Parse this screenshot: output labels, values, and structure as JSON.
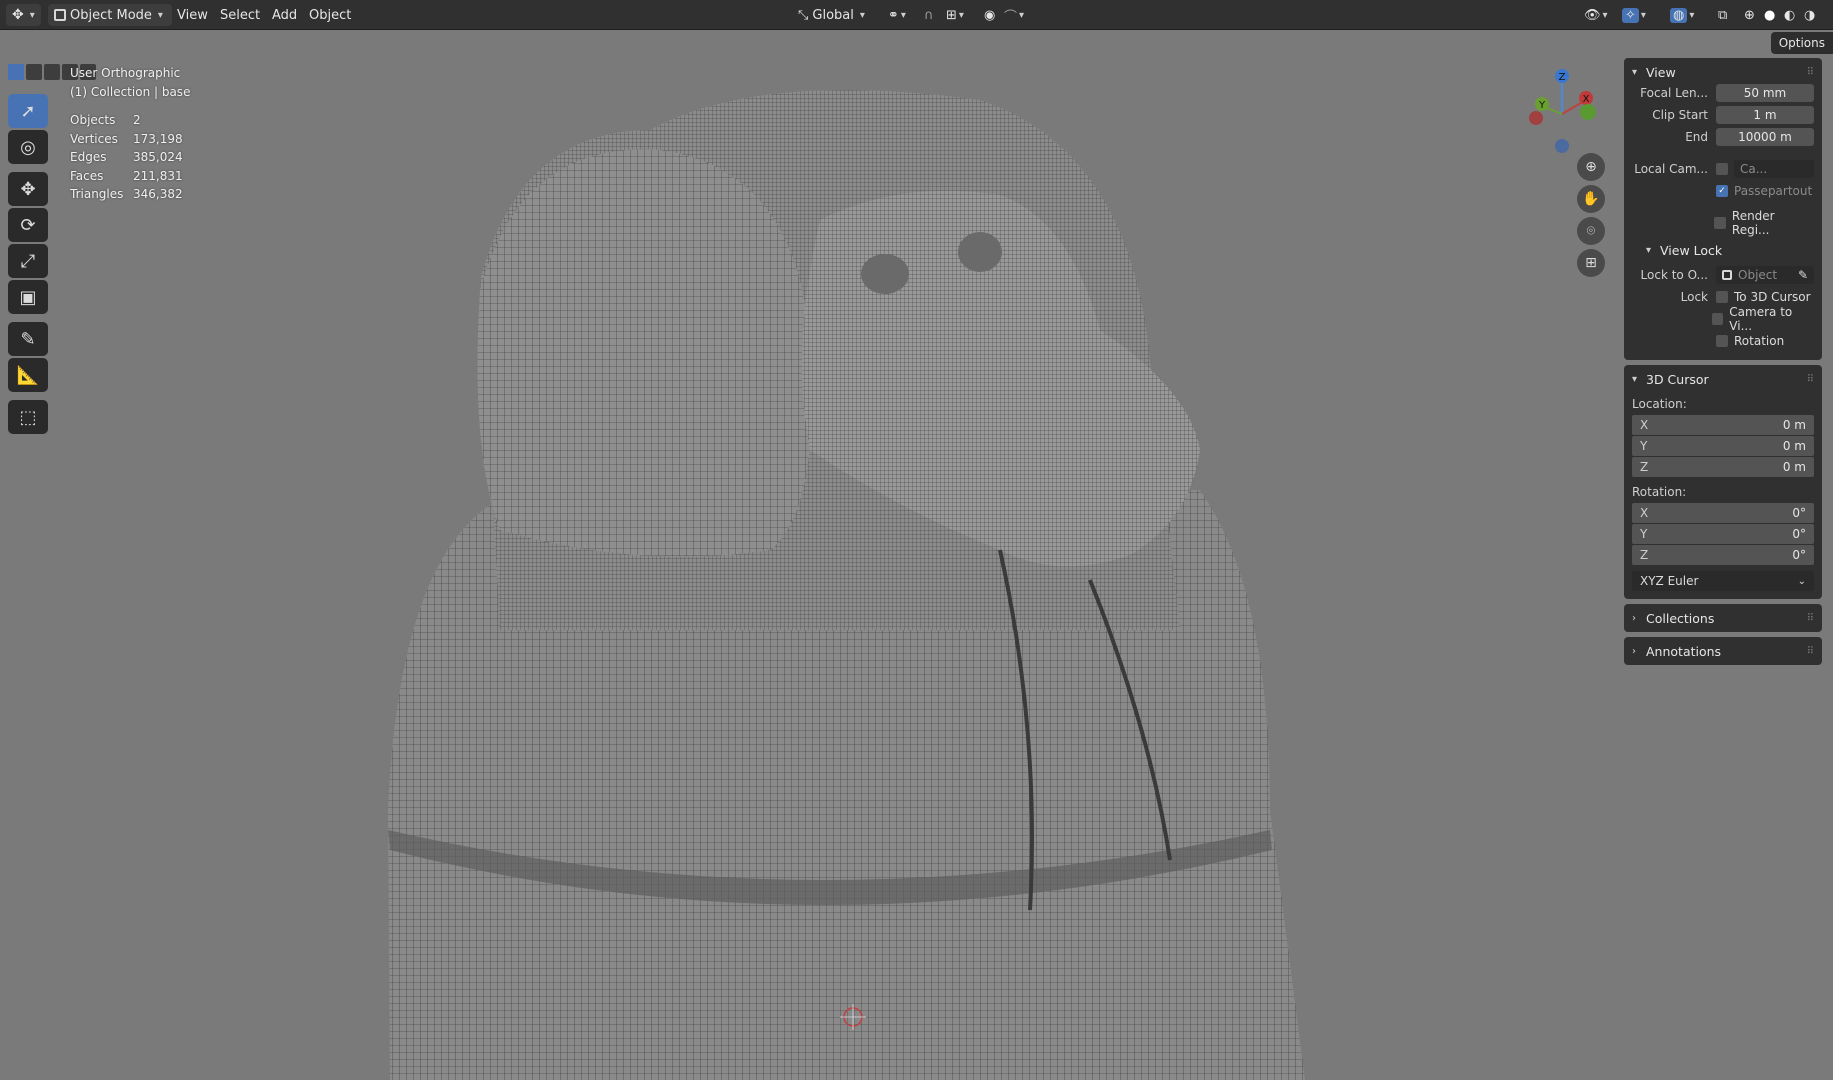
{
  "topbar": {
    "mode": "Object Mode",
    "menus": [
      "View",
      "Select",
      "Add",
      "Object"
    ],
    "orientation": "Global"
  },
  "viewport": {
    "view_name": "User Orthographic",
    "collection": "(1) Collection | base",
    "stats": [
      {
        "label": "Objects",
        "value": "2"
      },
      {
        "label": "Vertices",
        "value": "173,198"
      },
      {
        "label": "Edges",
        "value": "385,024"
      },
      {
        "label": "Faces",
        "value": "211,831"
      },
      {
        "label": "Triangles",
        "value": "346,382"
      }
    ],
    "gizmo": {
      "z": "Z",
      "y": "Y",
      "x": "X"
    },
    "options_label": "Options"
  },
  "npanel": {
    "view": {
      "title": "View",
      "focal_label": "Focal Len...",
      "focal_value": "50 mm",
      "clip_start_label": "Clip Start",
      "clip_start_value": "1 m",
      "end_label": "End",
      "end_value": "10000 m",
      "local_cam_label": "Local Cam...",
      "local_cam_value": "Ca...",
      "passepartout": "Passepartout",
      "render_region": "Render Regi...",
      "view_lock_title": "View Lock",
      "lock_to_label": "Lock to O...",
      "lock_to_placeholder": "Object",
      "lock_label": "Lock",
      "to_3d_cursor": "To 3D Cursor",
      "camera_to_view": "Camera to Vi...",
      "rotation": "Rotation"
    },
    "cursor": {
      "title": "3D Cursor",
      "location_label": "Location:",
      "location": [
        {
          "axis": "X",
          "value": "0 m"
        },
        {
          "axis": "Y",
          "value": "0 m"
        },
        {
          "axis": "Z",
          "value": "0 m"
        }
      ],
      "rotation_label": "Rotation:",
      "rotation": [
        {
          "axis": "X",
          "value": "0°"
        },
        {
          "axis": "Y",
          "value": "0°"
        },
        {
          "axis": "Z",
          "value": "0°"
        }
      ],
      "rotation_mode": "XYZ Euler"
    },
    "collections_title": "Collections",
    "annotations_title": "Annotations"
  },
  "colors": {
    "accent": "#4772b3",
    "viewport_bg": "#7a7a7a",
    "panel_bg": "#303030"
  }
}
